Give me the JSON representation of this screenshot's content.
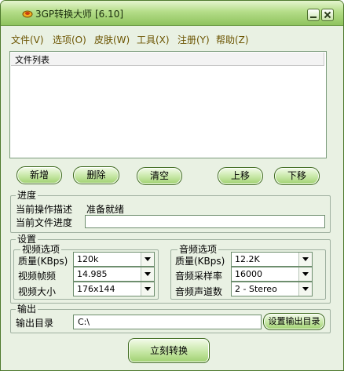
{
  "window": {
    "title": "3GP转换大师 [6.10]"
  },
  "menu": [
    "文件(V)",
    "选项(O)",
    "皮肤(W)",
    "工具(X)",
    "注册(Y)",
    "帮助(Z)"
  ],
  "file_list": {
    "header": "文件列表"
  },
  "buttons": {
    "add": "新增",
    "delete": "删除",
    "clear": "清空",
    "move_up": "上移",
    "move_down": "下移"
  },
  "progress": {
    "group_label": "进度",
    "op_label": "当前操作描述",
    "op_value": "准备就绪",
    "file_progress_label": "当前文件进度",
    "file_progress_value": 0
  },
  "settings": {
    "group_label": "设置",
    "video": {
      "label": "视频选项",
      "quality_label": "质量(KBps)",
      "quality_value": "120k",
      "fps_label": "视频帧频",
      "fps_value": "14.985",
      "size_label": "视频大小",
      "size_value": "176x144"
    },
    "audio": {
      "label": "音频选项",
      "quality_label": "质量(KBps)",
      "quality_value": "12.2K",
      "rate_label": "音频采样率",
      "rate_value": "16000",
      "channels_label": "音频声道数",
      "channels_value": "2 - Stereo"
    }
  },
  "output": {
    "group_label": "输出",
    "dir_label": "输出目录",
    "dir_value": "C:\\",
    "set_button": "设置输出目录"
  },
  "convert_button": "立刻转换",
  "colors": {
    "title_gradient_top": "#e5f5cf",
    "title_gradient_bottom": "#8fc35e",
    "button_green": "#9fd06f",
    "menu_text": "#6b5400",
    "window_bg": "#e9f1e3"
  }
}
